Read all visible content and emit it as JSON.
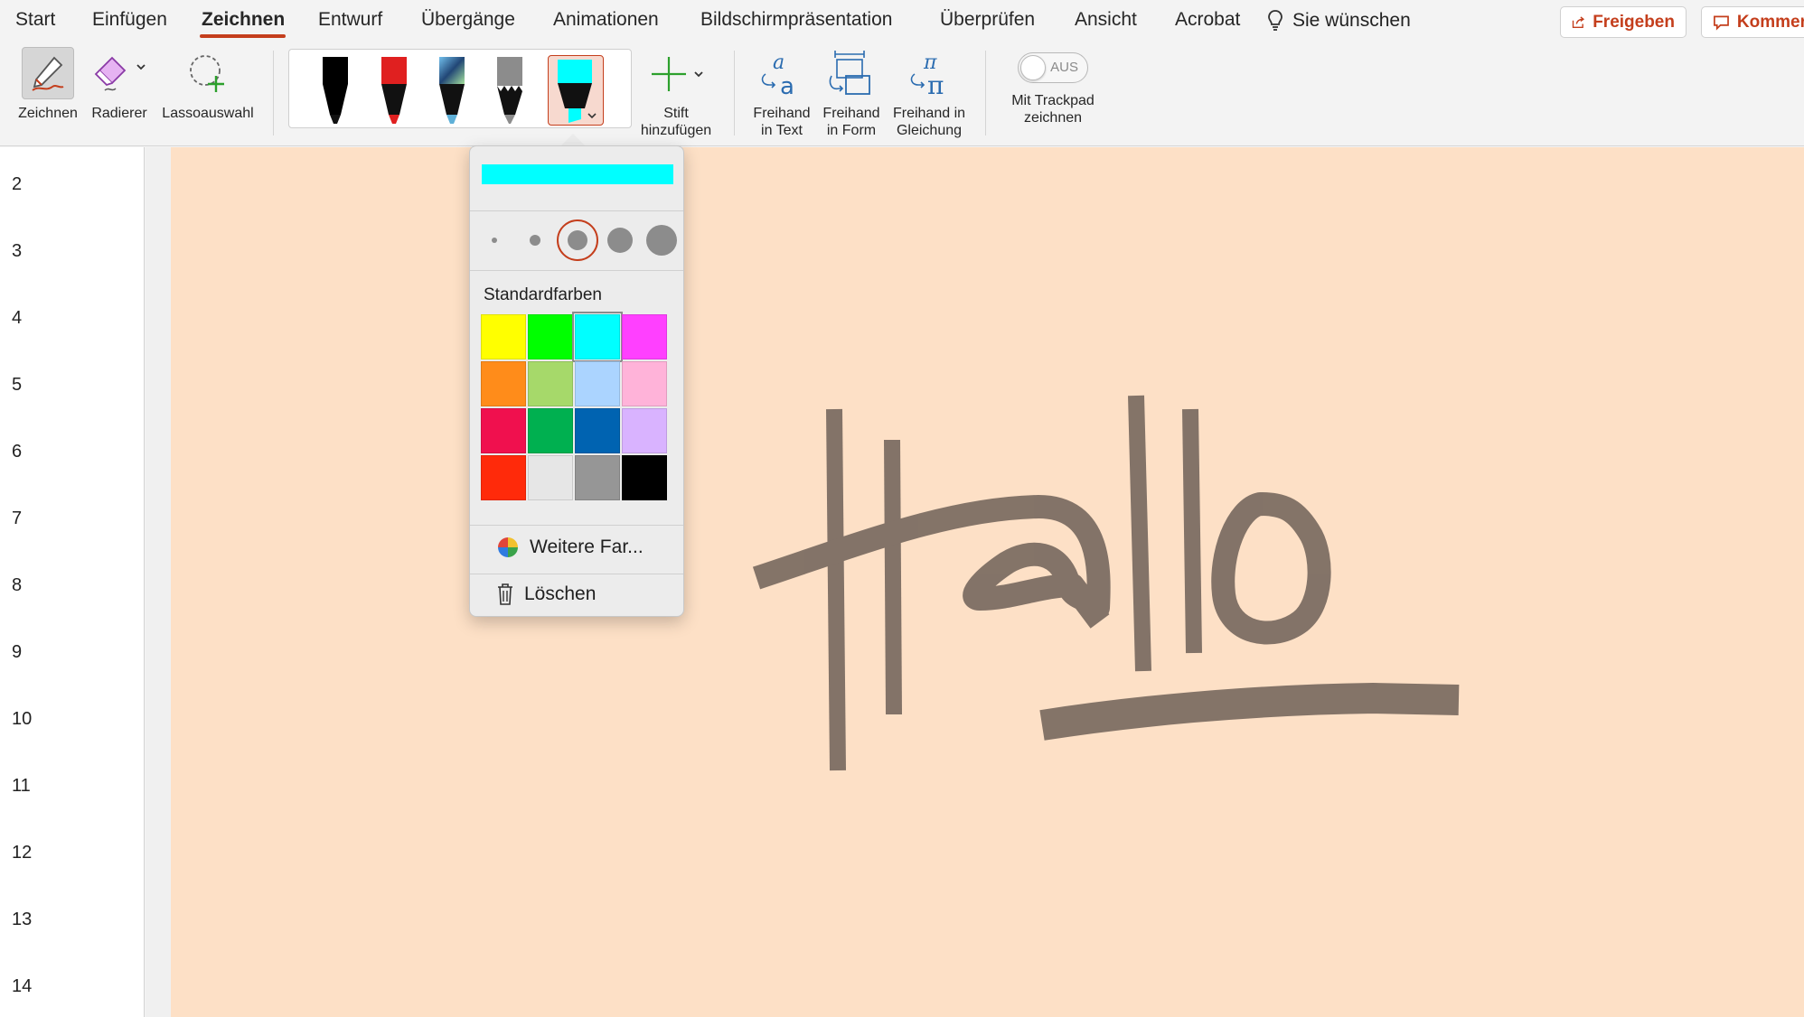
{
  "tabs": [
    {
      "label": "Start",
      "active": false
    },
    {
      "label": "Einfügen",
      "active": false
    },
    {
      "label": "Zeichnen",
      "active": true
    },
    {
      "label": "Entwurf",
      "active": false
    },
    {
      "label": "Übergänge",
      "active": false
    },
    {
      "label": "Animationen",
      "active": false
    },
    {
      "label": "Bildschirmpräsentation",
      "active": false
    },
    {
      "label": "Überprüfen",
      "active": false
    },
    {
      "label": "Ansicht",
      "active": false
    },
    {
      "label": "Acrobat",
      "active": false
    }
  ],
  "wish": {
    "label": "Sie wünschen",
    "icon": "lightbulb-icon"
  },
  "share_button": {
    "label": "Freigeben",
    "icon": "share-icon"
  },
  "comment_button": {
    "label": "Kommer",
    "icon": "comment-icon"
  },
  "ribbon": {
    "draw_tool": {
      "label": "Zeichnen",
      "icon": "draw-pen-icon"
    },
    "eraser": {
      "label": "Radierer",
      "icon": "eraser-icon"
    },
    "lasso": {
      "label": "Lassoauswahl",
      "icon": "lasso-icon"
    },
    "pens": [
      {
        "name": "black-pen",
        "color": "#000000"
      },
      {
        "name": "red-pen",
        "color": "#e02020"
      },
      {
        "name": "galaxy-pen",
        "color": "#3a6fa0"
      },
      {
        "name": "gray-pencil",
        "color": "#8c8c8c"
      },
      {
        "name": "cyan-highlighter",
        "color": "#00ffff",
        "selected": true
      }
    ],
    "add_pen": {
      "line1": "Stift",
      "line2": "hinzufügen"
    },
    "ink_to_text": {
      "line1": "Freihand",
      "line2": "in Text"
    },
    "ink_to_shape": {
      "line1": "Freihand",
      "line2": "in Form"
    },
    "ink_to_math": {
      "line1": "Freihand in",
      "line2": "Gleichung"
    },
    "trackpad": {
      "line1": "Mit Trackpad",
      "line2": "zeichnen",
      "toggle": "AUS"
    }
  },
  "ruler_numbers": [
    "2",
    "3",
    "4",
    "5",
    "6",
    "7",
    "8",
    "9",
    "10",
    "11",
    "12",
    "13",
    "14"
  ],
  "popup": {
    "preview_color": "#00ffff",
    "sizes_count": 5,
    "selected_size_index": 2,
    "colors_heading": "Standardfarben",
    "colors": [
      "#ffff00",
      "#00ff00",
      "#00ffff",
      "#ff40ff",
      "#ff8c1a",
      "#a6d96a",
      "#abd4ff",
      "#ffb3d9",
      "#f0104e",
      "#00b050",
      "#0063b1",
      "#d9b3ff",
      "#ff2a0a",
      "#e6e6e6",
      "#969696",
      "#000000"
    ],
    "selected_color_index": 2,
    "more_colors": "Weitere Far...",
    "delete": "Löschen"
  },
  "ink_color": "#7d6e63",
  "slide_bg": "#fde0c6"
}
